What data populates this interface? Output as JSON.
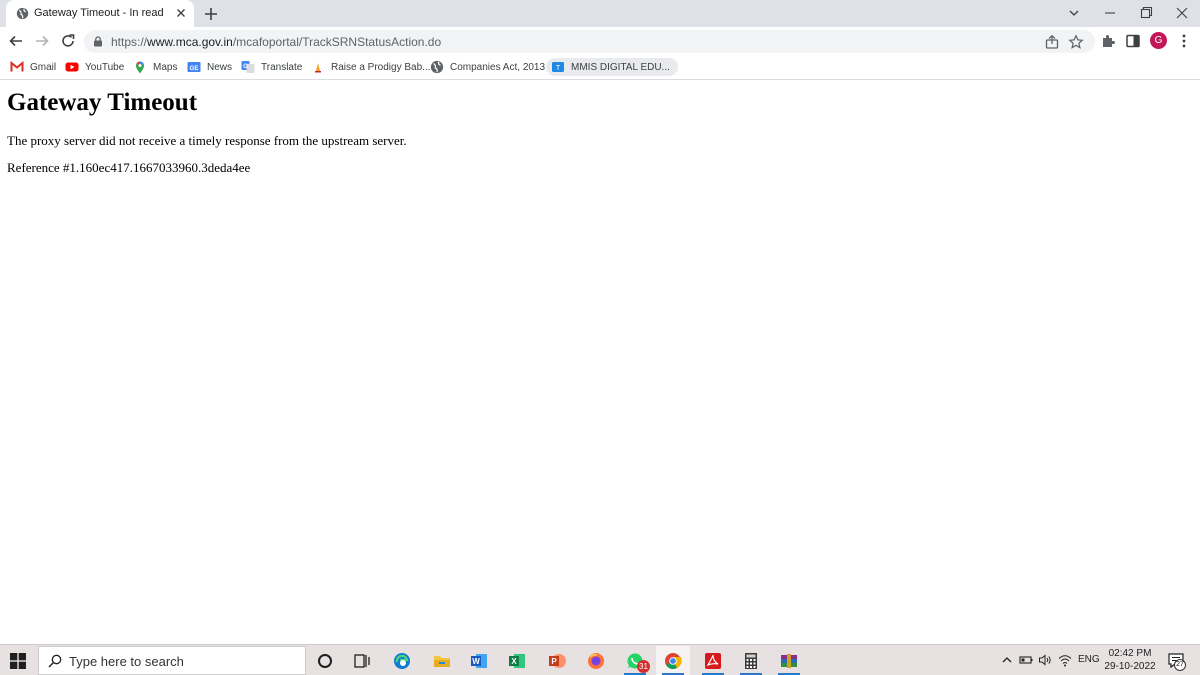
{
  "browser": {
    "tab": {
      "title": "Gateway Timeout - In read",
      "favicon": "globe-icon"
    },
    "window_controls": [
      "tab-search-icon",
      "minimize-icon",
      "restore-icon",
      "close-icon"
    ],
    "url": {
      "scheme": "https://",
      "host": "www.mca.gov.in",
      "path": "/mcafoportal/TrackSRNStatusAction.do"
    },
    "profile_initial": "G",
    "bookmarks": [
      {
        "label": "Gmail",
        "icon": "gmail-icon",
        "color": "#d93025"
      },
      {
        "label": "YouTube",
        "icon": "youtube-icon",
        "color": "#ff0000"
      },
      {
        "label": "Maps",
        "icon": "maps-icon",
        "color": "#34a853"
      },
      {
        "label": "News",
        "icon": "news-icon",
        "color": "#4285f4"
      },
      {
        "label": "Translate",
        "icon": "translate-icon",
        "color": "#4285f4"
      },
      {
        "label": "Raise a Prodigy Bab...",
        "icon": "prodigy-icon",
        "color": "#f4a11a"
      },
      {
        "label": "Companies Act, 2013",
        "icon": "globe-icon",
        "color": "#5f6368"
      },
      {
        "label": "MMIS DIGITAL EDU...",
        "icon": "mmis-icon",
        "color": "#1e88e5"
      }
    ]
  },
  "page": {
    "heading": "Gateway Timeout",
    "message": "The proxy server did not receive a timely response from the upstream server.",
    "reference": "Reference #1.160ec417.1667033960.3deda4ee"
  },
  "taskbar": {
    "search_placeholder": "Type here to search",
    "apps": [
      "cortana-icon",
      "task-view-icon",
      "edge-icon",
      "file-explorer-icon",
      "word-icon",
      "excel-icon",
      "powerpoint-icon",
      "firefox-icon",
      "whatsapp-icon",
      "chrome-icon",
      "acrobat-icon",
      "calculator-icon",
      "winrar-icon"
    ],
    "whatsapp_badge": "31",
    "language": "ENG",
    "time": "02:42 PM",
    "date": "29-10-2022",
    "notifications": "27"
  }
}
